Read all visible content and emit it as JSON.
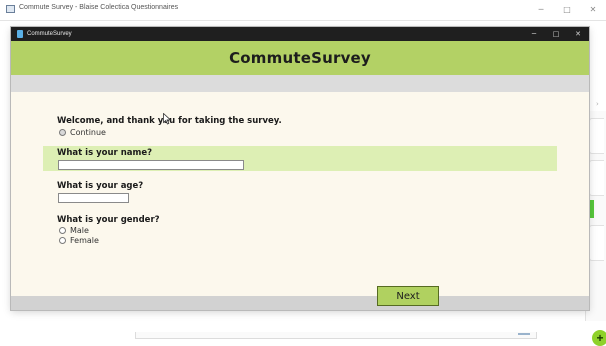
{
  "outer_window": {
    "title": "Commute Survey - Blaise Colectica Questionnaires",
    "controls": {
      "minimize": "─",
      "maximize": "□",
      "close": "✕"
    }
  },
  "dialog": {
    "title": "CommuteSurvey",
    "controls": {
      "minimize": "─",
      "maximize": "□",
      "close": "✕"
    }
  },
  "banner": {
    "title": "CommuteSurvey"
  },
  "questions": {
    "welcome": {
      "text": "Welcome, and thank you for taking the survey.",
      "options": [
        "Continue"
      ]
    },
    "name": {
      "text": "What is your name?",
      "value": ""
    },
    "age": {
      "text": "What is your age?",
      "value": ""
    },
    "gender": {
      "text": "What is your gender?",
      "options": [
        "Male",
        "Female"
      ]
    }
  },
  "footer": {
    "next_label": "Next"
  },
  "fab": {
    "label": "+"
  },
  "colors": {
    "banner": "#b3d165",
    "highlight_row": "#ddefb4",
    "page_bg": "#fcf8ed",
    "next_button": "#b0d160",
    "fab": "#8fd12a"
  }
}
